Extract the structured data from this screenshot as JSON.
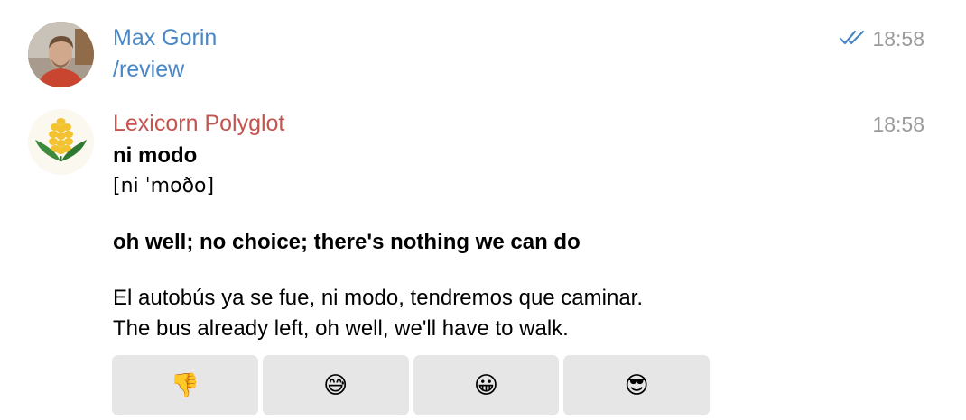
{
  "messages": [
    {
      "sender": "Max Gorin",
      "time": "18:58",
      "text": "/review",
      "status_icon": "double-check-icon"
    },
    {
      "sender": "Lexicorn Polyglot",
      "time": "18:58",
      "term": "ni modo",
      "pronunciation": "[ni ˈmoðo]",
      "definition": "oh well; no choice; there's nothing we can do",
      "example_es": "El autobús ya se fue, ni modo, tendremos que caminar.",
      "example_en": "The bus already left, oh well, we'll have to walk.",
      "avatar_icon": "corn-icon"
    }
  ],
  "keyboard": [
    {
      "emoji": "👎",
      "name": "thumbs-down"
    },
    {
      "emoji": "😅",
      "name": "sweat-smile"
    },
    {
      "emoji": "😀",
      "name": "grinning"
    },
    {
      "emoji": "😎",
      "name": "sunglasses"
    }
  ],
  "colors": {
    "user_name": "#4a86c5",
    "bot_name": "#c5534f",
    "timestamp": "#9a9a9a",
    "button_bg": "#e6e6e6"
  }
}
